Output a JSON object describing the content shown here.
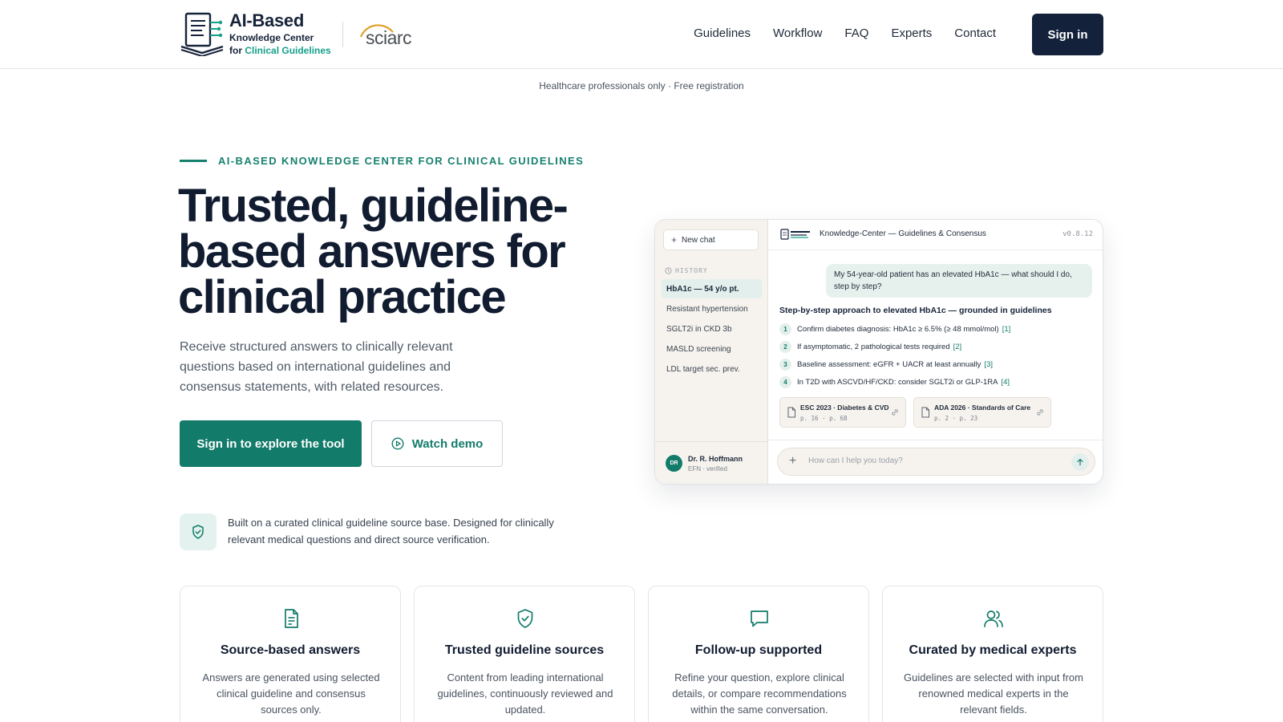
{
  "brand": {
    "title": "AI-Based",
    "subtitle_line1": "Knowledge Center",
    "subtitle_for": "for",
    "subtitle_accent": "Clinical Guidelines",
    "partner": "sciarc"
  },
  "nav": {
    "items": [
      "Guidelines",
      "Workflow",
      "FAQ",
      "Experts",
      "Contact"
    ],
    "signin": "Sign in"
  },
  "notice": "Healthcare professionals only · Free registration",
  "hero": {
    "eyebrow": "AI-BASED KNOWLEDGE CENTER FOR CLINICAL GUIDELINES",
    "title": "Trusted, guideline-based answers for clinical practice",
    "description": "Receive structured answers to clinically relevant questions based on international guidelines and consensus statements, with related resources.",
    "cta_primary": "Sign in to explore the tool",
    "cta_secondary": "Watch demo",
    "trust_text": "Built on a curated clinical guideline source base. Designed for clinically relevant medical questions and direct source verification."
  },
  "mock": {
    "new_chat": "New chat",
    "history_label": "HISTORY",
    "history": [
      "HbA1c — 54 y/o pt.",
      "Resistant hypertension",
      "SGLT2i in CKD 3b",
      "MASLD screening",
      "LDL target sec. prev."
    ],
    "user": {
      "initials": "DR",
      "name": "Dr. R. Hoffmann",
      "meta": "EFN · verified"
    },
    "title": "Knowledge-Center — Guidelines & Consensus",
    "version": "v0.8.12",
    "user_message": "My 54-year-old patient has an elevated HbA1c — what should I do, step by step?",
    "answer_title": "Step-by-step approach to elevated HbA1c — grounded in guidelines",
    "steps": [
      {
        "num": "1",
        "text": "Confirm diabetes diagnosis: HbA1c ≥ 6.5% (≥ 48 mmol/mol)",
        "cite": "[1]"
      },
      {
        "num": "2",
        "text": "If asymptomatic, 2 pathological tests required",
        "cite": "[2]"
      },
      {
        "num": "3",
        "text": "Baseline assessment: eGFR + UACR at least annually",
        "cite": "[3]"
      },
      {
        "num": "4",
        "text": "In T2D with ASCVD/HF/CKD: consider SGLT2i or GLP-1RA",
        "cite": "[4]"
      }
    ],
    "sources": [
      {
        "name": "ESC 2023 · Diabetes & CVD",
        "pages": "p. 16 · p. 68"
      },
      {
        "name": "ADA 2026 · Standards of Care",
        "pages": "p. 2 · p. 23"
      }
    ],
    "input_placeholder": "How can I help you today?"
  },
  "features": [
    {
      "icon": "document-icon",
      "title": "Source-based answers",
      "desc": "Answers are generated using selected clinical guideline and consensus sources only."
    },
    {
      "icon": "shield-check-icon",
      "title": "Trusted guideline sources",
      "desc": "Content from leading international guidelines, continuously reviewed and updated."
    },
    {
      "icon": "chat-bubble-icon",
      "title": "Follow-up supported",
      "desc": "Refine your question, explore clinical details, or compare recommendations within the same conversation."
    },
    {
      "icon": "users-icon",
      "title": "Curated by medical experts",
      "desc": "Guidelines are selected with input from renowned medical experts in the relevant fields."
    }
  ],
  "colors": {
    "accent": "#137b6a",
    "navy": "#13213a",
    "accent_light": "#e3efec"
  }
}
